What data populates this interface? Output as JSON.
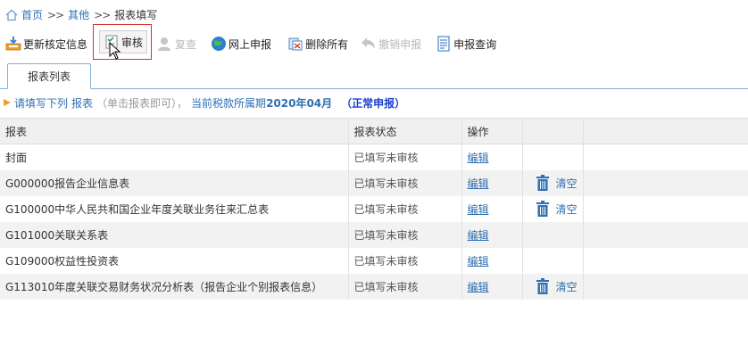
{
  "breadcrumb": {
    "home": "首页",
    "sep1": ">>",
    "other": "其他",
    "sep2": ">>",
    "current": "报表填写"
  },
  "toolbar": {
    "update": "更新核定信息",
    "review": "审核",
    "recheck": "复查",
    "online_submit": "网上申报",
    "delete_all": "删除所有",
    "cancel_submit": "撤销申报",
    "query": "申报查询"
  },
  "tab": {
    "label": "报表列表"
  },
  "notice": {
    "fill_prefix": "请填写下列",
    "report": "报表",
    "hint": "（单击报表即可），",
    "period_prefix": "当前税款所属期",
    "period": "2020年04月",
    "type": "（正常申报）"
  },
  "table": {
    "headers": {
      "name": "报表",
      "status": "报表状态",
      "op": "操作"
    },
    "rows": [
      {
        "name": "封面",
        "status": "已填写未审核",
        "edit": "编辑",
        "clear": ""
      },
      {
        "name": "G000000报告企业信息表",
        "status": "已填写未审核",
        "edit": "编辑",
        "clear": "清空"
      },
      {
        "name": "G100000中华人民共和国企业年度关联业务往来汇总表",
        "status": "已填写未审核",
        "edit": "编辑",
        "clear": "清空"
      },
      {
        "name": "G101000关联关系表",
        "status": "已填写未审核",
        "edit": "编辑",
        "clear": ""
      },
      {
        "name": "G109000权益性投资表",
        "status": "已填写未审核",
        "edit": "编辑",
        "clear": ""
      },
      {
        "name": "G113010年度关联交易财务状况分析表（报告企业个别报表信息）",
        "status": "已填写未审核",
        "edit": "编辑",
        "clear": "清空"
      }
    ]
  },
  "colors": {
    "link": "#2f6fb3",
    "accent_red": "#d63030",
    "tab_border": "#7fb0d8"
  }
}
